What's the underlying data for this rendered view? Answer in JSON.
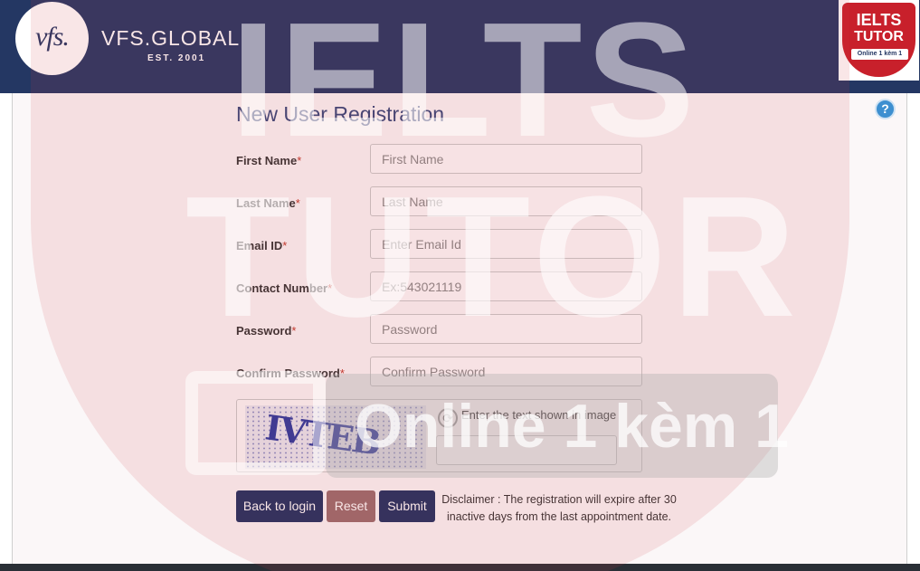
{
  "header": {
    "logo_text": "vfs.",
    "brand": "VFS.GLOBAL",
    "est": "EST. 2001"
  },
  "badge": {
    "line1": "IELTS",
    "line2": "TUTOR",
    "line3": "Online 1 kèm 1"
  },
  "watermark": {
    "line1": "IELTS",
    "line2": "TUTOR",
    "line3": "Online 1 kèm 1"
  },
  "help": {
    "icon": "question-mark-icon",
    "glyph": "?"
  },
  "form": {
    "title": "New User Registration",
    "required_mark": "*",
    "fields": [
      {
        "label": "First Name",
        "placeholder": "First Name"
      },
      {
        "label": "Last Name",
        "placeholder": "Last Name"
      },
      {
        "label": "Email ID",
        "placeholder": "Enter Email Id"
      },
      {
        "label": "Contact Number",
        "placeholder": "Ex:543021119"
      },
      {
        "label": "Password",
        "placeholder": "Password"
      },
      {
        "label": "Confirm Password",
        "placeholder": "Confirm Password"
      }
    ],
    "captcha": {
      "image_text": "IVTEB",
      "label": "Enter the text shown in image",
      "refresh_icon": "refresh-icon"
    },
    "buttons": {
      "back": "Back to login",
      "reset": "Reset",
      "submit": "Submit"
    },
    "disclaimer": "Disclaimer : The registration will expire after 30 inactive days from the last appointment date."
  },
  "colors": {
    "header_bg": "#243763",
    "primary_button": "#1f3161",
    "reset_button": "#9a6d6e",
    "required": "#c0392b"
  }
}
